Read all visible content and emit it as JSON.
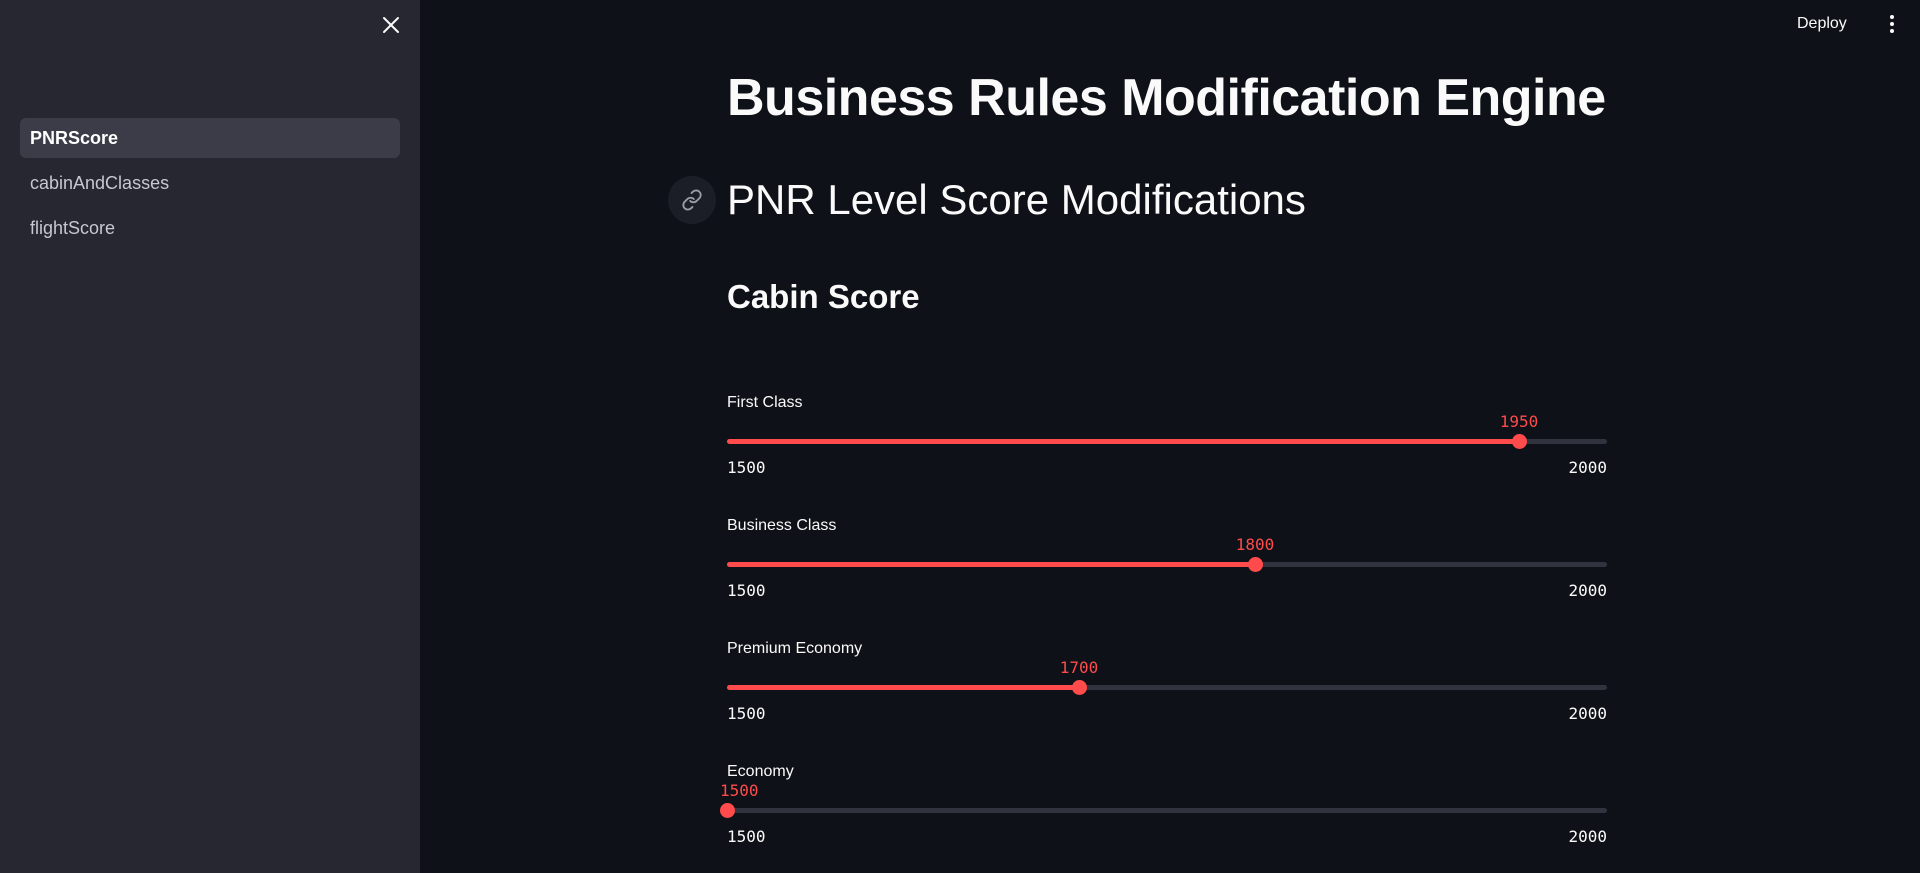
{
  "sidebar": {
    "items": [
      {
        "label": "PNRScore",
        "active": true
      },
      {
        "label": "cabinAndClasses",
        "active": false
      },
      {
        "label": "flightScore",
        "active": false
      }
    ]
  },
  "toolbar": {
    "deploy_label": "Deploy"
  },
  "main": {
    "title": "Business Rules Modification Engine",
    "section_title": "PNR Level Score Modifications",
    "subsection_title": "Cabin Score"
  },
  "sliders": [
    {
      "label": "First Class",
      "min": 1500,
      "max": 2000,
      "value": 1950,
      "min_label": "1500",
      "max_label": "2000",
      "value_label": "1950"
    },
    {
      "label": "Business Class",
      "min": 1500,
      "max": 2000,
      "value": 1800,
      "min_label": "1500",
      "max_label": "2000",
      "value_label": "1800"
    },
    {
      "label": "Premium Economy",
      "min": 1500,
      "max": 2000,
      "value": 1700,
      "min_label": "1500",
      "max_label": "2000",
      "value_label": "1700"
    },
    {
      "label": "Economy",
      "min": 1500,
      "max": 2000,
      "value": 1500,
      "min_label": "1500",
      "max_label": "2000",
      "value_label": "1500"
    }
  ],
  "colors": {
    "accent": "#ff4b4b",
    "background": "#0e1117",
    "sidebar": "#262730"
  },
  "icons": {
    "close": "close-icon",
    "link": "link-icon",
    "menu": "vertical-dots-icon"
  }
}
